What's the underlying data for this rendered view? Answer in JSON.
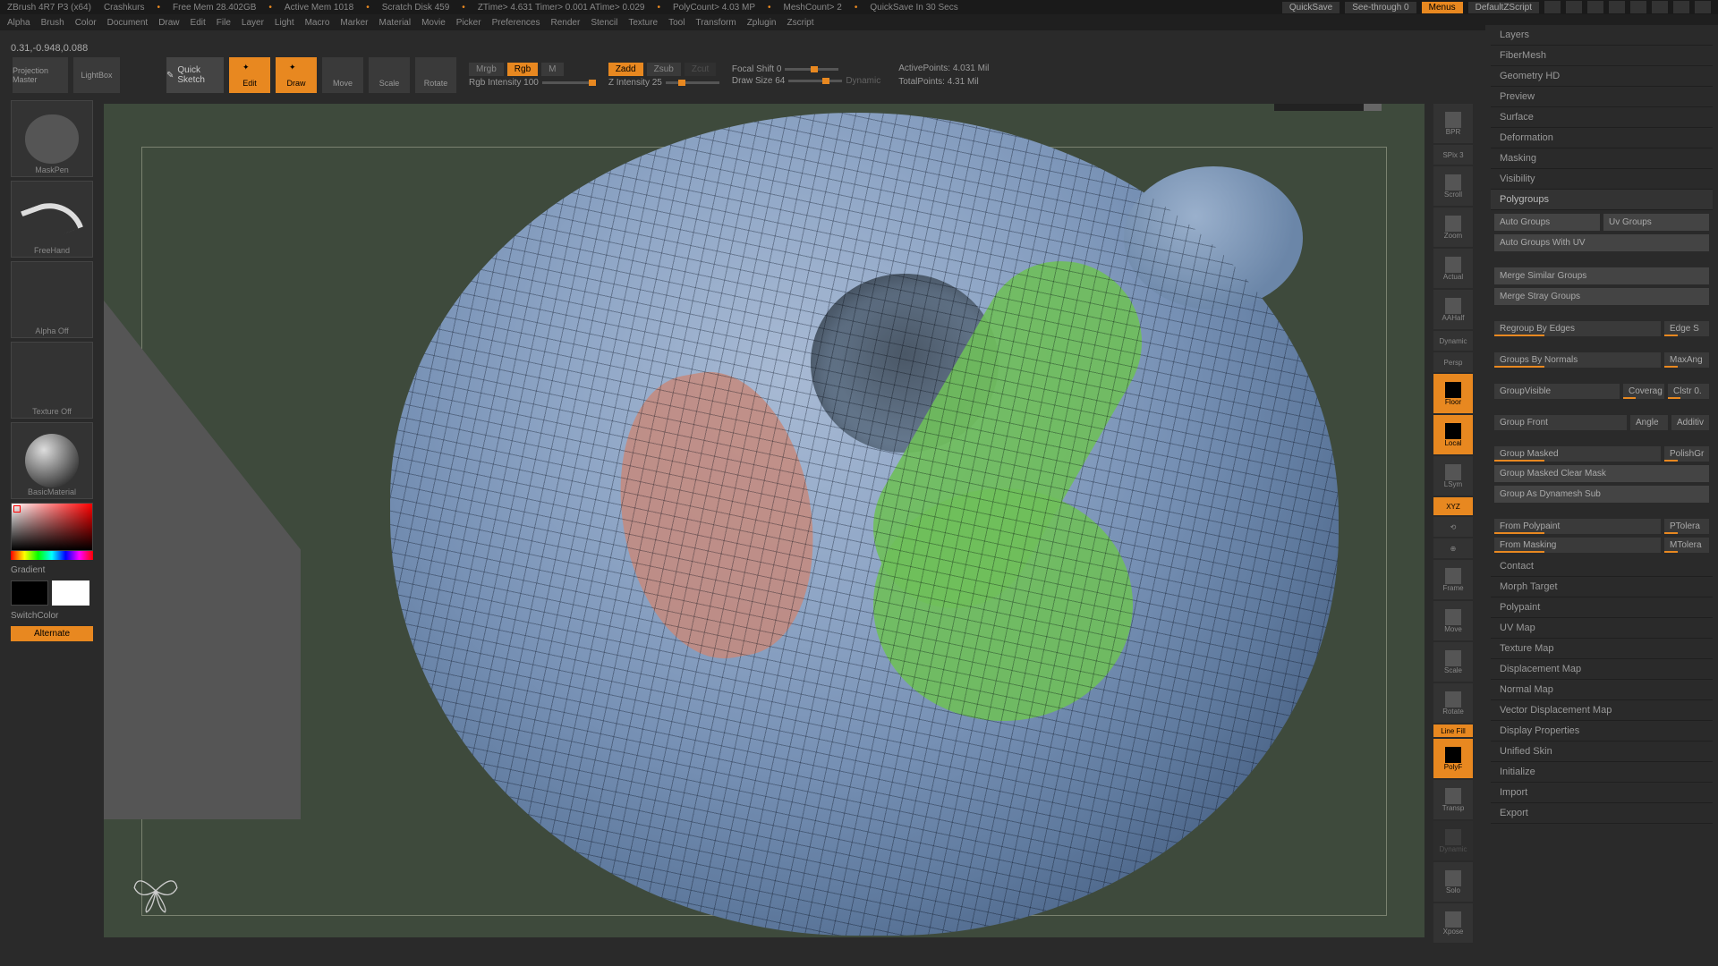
{
  "title_bar": {
    "app": "ZBrush 4R7 P3 (x64)",
    "doc": "Crashkurs",
    "stats": [
      "Free Mem 28.402GB",
      "Active Mem 1018",
      "Scratch Disk 459",
      "ZTime> 4.631  Timer> 0.001  ATime> 0.029",
      "PolyCount> 4.03 MP",
      "MeshCount> 2",
      "QuickSave In 30 Secs"
    ],
    "quicksave": "QuickSave",
    "seethrough": "See-through  0",
    "menus": "Menus",
    "script": "DefaultZScript"
  },
  "menu": [
    "Alpha",
    "Brush",
    "Color",
    "Document",
    "Draw",
    "Edit",
    "File",
    "Layer",
    "Light",
    "Macro",
    "Marker",
    "Material",
    "Movie",
    "Picker",
    "Preferences",
    "Render",
    "Stencil",
    "Texture",
    "Tool",
    "Transform",
    "Zplugin",
    "Zscript"
  ],
  "coords": "0.31,-0.948,0.088",
  "shelf": {
    "projection": "Projection Master",
    "lightbox": "LightBox",
    "sketch": "Quick Sketch",
    "tools": [
      {
        "label": "Edit",
        "active": true
      },
      {
        "label": "Draw",
        "active": true
      },
      {
        "label": "Move",
        "active": false
      },
      {
        "label": "Scale",
        "active": false
      },
      {
        "label": "Rotate",
        "active": false
      }
    ],
    "modes": {
      "mrgb": "Mrgb",
      "rgb": "Rgb",
      "m": "M",
      "rgb_int": "Rgb Intensity 100",
      "zadd": "Zadd",
      "zsub": "Zsub",
      "zcut": "Zcut",
      "z_int": "Z Intensity 25",
      "focal": "Focal Shift 0",
      "draw": "Draw Size 64",
      "dynamic": "Dynamic"
    },
    "stats": {
      "active": "ActivePoints: 4.031 Mil",
      "total": "TotalPoints: 4.31 Mil"
    }
  },
  "left": {
    "brush": "MaskPen",
    "stroke": "FreeHand",
    "alpha": "Alpha Off",
    "texture": "Texture Off",
    "material": "BasicMaterial",
    "gradient": "Gradient",
    "switch": "SwitchColor",
    "alternate": "Alternate"
  },
  "vtools": [
    "BPR",
    "SPix 3",
    "Scroll",
    "Zoom",
    "Actual",
    "AAHalf",
    "Dynamic",
    "Persp",
    "",
    "Floor",
    "Local",
    "",
    "LSym",
    "XYZ",
    "",
    "",
    "Frame",
    "",
    "Move",
    "",
    "Scale",
    "",
    "Rotate",
    "Line Fill",
    "PolyF",
    "",
    "Transp",
    "Dynamic",
    "",
    "Solo",
    "",
    "Xpose"
  ],
  "right": {
    "sections_top": [
      "Layers",
      "FiberMesh",
      "Geometry HD",
      "Preview",
      "Surface",
      "Deformation",
      "Masking",
      "Visibility"
    ],
    "polygroups": {
      "title": "Polygroups",
      "auto": "Auto Groups",
      "uv": "Uv Groups",
      "auto_uv": "Auto Groups With UV",
      "merge_sim": "Merge Similar Groups",
      "merge_stray": "Merge Stray Groups",
      "edges": "Regroup By Edges",
      "edge_s": "Edge S",
      "normals": "Groups By Normals",
      "maxang": "MaxAng",
      "visible": "GroupVisible",
      "coverage": "Coverag",
      "cluster": "Clstr 0.",
      "front": "Group Front",
      "angle": "Angle",
      "additive": "Additiv",
      "masked": "Group Masked",
      "polish": "PolishGr",
      "masked_clear": "Group Masked Clear Mask",
      "dynamesh": "Group As Dynamesh Sub",
      "polypaint": "From Polypaint",
      "ptol": "PTolera",
      "masking": "From Masking",
      "mtol": "MTolera"
    },
    "sections_bottom": [
      "Contact",
      "Morph Target",
      "Polypaint",
      "UV Map",
      "Texture Map",
      "Displacement Map",
      "Normal Map",
      "Vector Displacement Map",
      "Display Properties",
      "Unified Skin",
      "Initialize",
      "Import",
      "Export"
    ]
  }
}
